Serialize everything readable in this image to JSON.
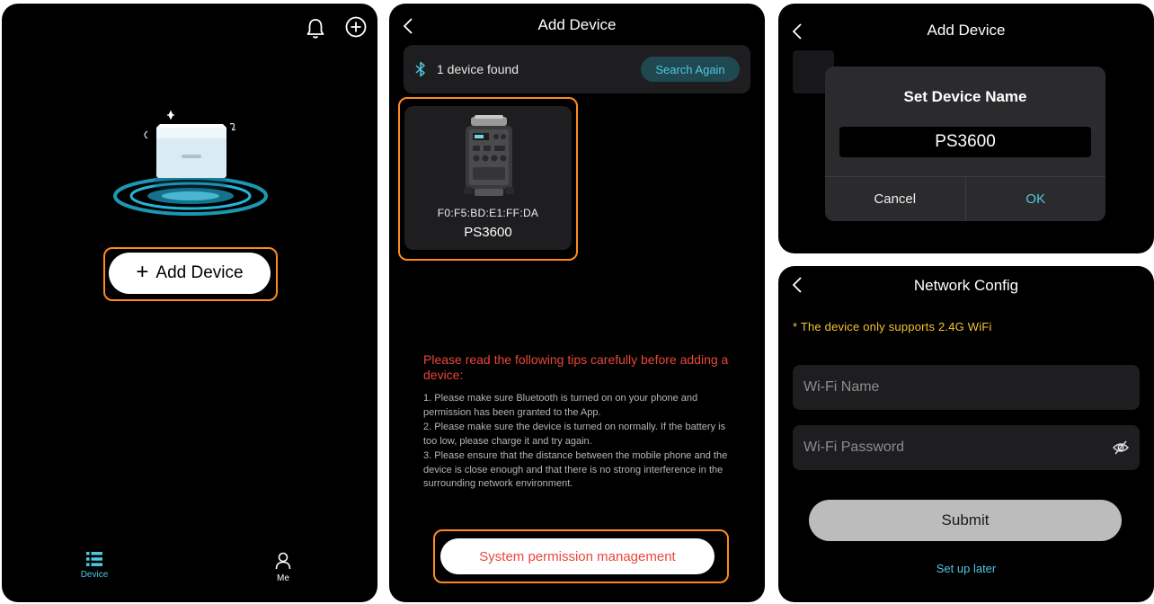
{
  "home": {
    "add_device_label": "Add Device",
    "tabs": [
      {
        "label": "Device",
        "icon": "list-icon",
        "active": true
      },
      {
        "label": "Me",
        "icon": "person-icon",
        "active": false
      }
    ]
  },
  "add_device": {
    "title": "Add Device",
    "found_text": "1 device found",
    "search_again_label": "Search Again",
    "device": {
      "mac": "F0:F5:BD:E1:FF:DA",
      "name": "PS3600"
    },
    "tips_title": "Please read the following tips carefully before adding a device:",
    "tips": [
      "1. Please make sure Bluetooth is turned on on your phone and permission has been granted to the App.",
      "2. Please make sure the device is turned on normally. If the battery is too low, please charge it and try again.",
      "3. Please ensure that the distance between the mobile phone and the device is close enough and that there is no strong interference in the surrounding network environment."
    ],
    "permission_button_label": "System permission management"
  },
  "set_name": {
    "title": "Add Device",
    "dialog_title": "Set Device Name",
    "name_value": "PS3600",
    "cancel_label": "Cancel",
    "ok_label": "OK"
  },
  "network": {
    "title": "Network Config",
    "note": "* The device only supports 2.4G WiFi",
    "wifi_name_placeholder": "Wi-Fi Name",
    "wifi_password_placeholder": "Wi-Fi Password",
    "submit_label": "Submit",
    "later_label": "Set up later"
  },
  "colors": {
    "accent": "#4fc8df",
    "highlight": "#ff8a1f",
    "warning": "#e8473a",
    "note": "#f4c430"
  }
}
